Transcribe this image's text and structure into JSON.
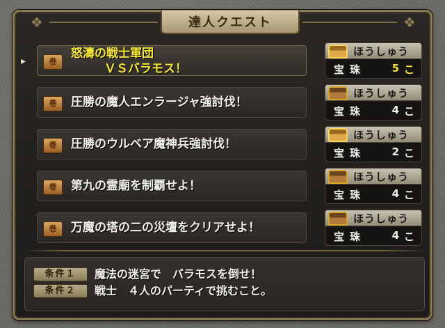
{
  "window": {
    "title": "達人クエスト"
  },
  "quests": [
    {
      "name_line1": "怒濤の戦士軍団",
      "name_line2": "ＶＳバラモス！",
      "reward_name": "ほうしゅう",
      "reward_label": "宝珠",
      "reward_count": "5",
      "reward_unit": "こ",
      "selected": true
    },
    {
      "name_line1": "圧勝の魔人エンラージャ強討伐！",
      "name_line2": "",
      "reward_name": "ほうしゅう",
      "reward_label": "宝珠",
      "reward_count": "4",
      "reward_unit": "こ",
      "selected": false
    },
    {
      "name_line1": "圧勝のウルベア魔神兵強討伐！",
      "name_line2": "",
      "reward_name": "ほうしゅう",
      "reward_label": "宝珠",
      "reward_count": "2",
      "reward_unit": "こ",
      "selected": false
    },
    {
      "name_line1": "第九の霊廟を制覇せよ！",
      "name_line2": "",
      "reward_name": "ほうしゅう",
      "reward_label": "宝珠",
      "reward_count": "4",
      "reward_unit": "こ",
      "selected": false
    },
    {
      "name_line1": "万魔の塔の二の災壇をクリアせよ！",
      "name_line2": "",
      "reward_name": "ほうしゅう",
      "reward_label": "宝珠",
      "reward_count": "4",
      "reward_unit": "こ",
      "selected": false
    }
  ],
  "conditions": [
    {
      "tag": "条件１",
      "text": "魔法の迷宮で　バラモスを倒せ！"
    },
    {
      "tag": "条件２",
      "text": "戦士　４人のパーティで挑むこと。"
    }
  ],
  "colors": {
    "highlight": "#f5e63a",
    "text": "#f2f0ea",
    "frame": "#8c7a52",
    "panel": "#2a2724"
  },
  "icons": {
    "quest": "scroll-icon",
    "reward": "treasure-chest-icon",
    "cursor": "pointer-icon"
  }
}
